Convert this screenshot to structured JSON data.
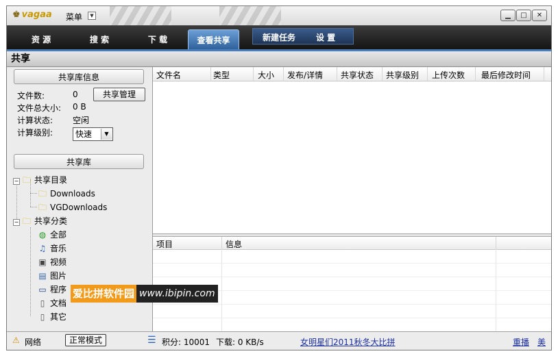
{
  "app": {
    "logo": "vagaa",
    "menu": "菜单"
  },
  "window_buttons": [
    "minimize-icon",
    "maximize-icon",
    "close-icon"
  ],
  "tabs": [
    {
      "label": "资 源"
    },
    {
      "label": "搜 索"
    },
    {
      "label": "下 载"
    },
    {
      "label": "查看共享",
      "active": true
    }
  ],
  "toolbar": {
    "new_task": "新建任务",
    "settings": "设 置"
  },
  "page_title": "共享",
  "share_info": {
    "title": "共享库信息",
    "file_count_label": "文件数:",
    "file_count": "0",
    "total_size_label": "文件总大小:",
    "total_size": "0 B",
    "calc_status_label": "计算状态:",
    "calc_status": "空闲",
    "calc_level_label": "计算级别:",
    "calc_level": "快速",
    "manage_button": "共享管理"
  },
  "library": {
    "title": "共享库",
    "dir_root": "共享目录",
    "dirs": [
      "Downloads",
      "VGDownloads"
    ],
    "cat_root": "共享分类",
    "categories": [
      "全部",
      "音乐",
      "视频",
      "图片",
      "程序",
      "文档",
      "其它"
    ]
  },
  "file_table": {
    "columns": [
      "文件名",
      "类型",
      "大小",
      "发布/详情",
      "共享状态",
      "共享级别",
      "上传次数",
      "最后修改时间"
    ]
  },
  "detail_table": {
    "columns": [
      "项目",
      "信息"
    ]
  },
  "watermark": {
    "cn": "爱比拼软件园",
    "url": "www.ibipin.com"
  },
  "status": {
    "network": "网络",
    "mode": "正常模式",
    "points": "积分: 10001",
    "download": "下载: 0 KB/s",
    "promo": "女明星们2011秋冬大比拼",
    "link1": "重播",
    "link2": "美"
  },
  "colors": {
    "tab_active": "#2d5f99",
    "watermark_bg": "#f29a1a",
    "link": "#1b2f9e",
    "status_icon": "#2a63b8"
  }
}
